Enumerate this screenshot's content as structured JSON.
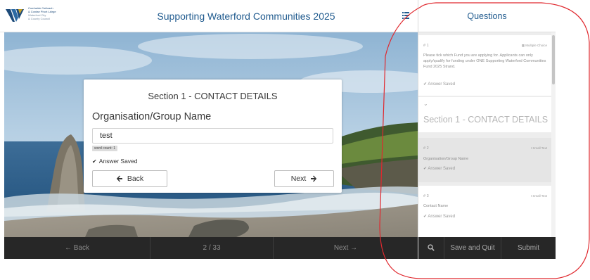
{
  "header": {
    "logo_lines": [
      "Comhairle Cathrach",
      "& Contae Phort Láirge",
      "Waterford City",
      "& County Council"
    ],
    "title": "Supporting Waterford Communities 2025",
    "toggle_icon": "list-icon"
  },
  "card": {
    "section_title": "Section 1 - CONTACT DETAILS",
    "question_title": "Organisation/Group Name",
    "answer_value": "test",
    "word_count": "word count: 1",
    "saved_text": "Answer Saved",
    "back_label": "Back",
    "next_label": "Next"
  },
  "bottom_nav": {
    "back_label": "Back",
    "progress": "2 / 33",
    "next_label": "Next"
  },
  "questions_panel": {
    "title": "Questions",
    "items": [
      {
        "number": "# 1",
        "type": "Multiple Choice",
        "text": "Please tick which Fund you are applying for. Applicants can only apply/qualify for funding under ONE Supporting Waterford Communities Fund 2025 Strand.",
        "saved": "Answer Saved"
      },
      {
        "section": "Section 1 - CONTACT DETAILS"
      },
      {
        "number": "# 2",
        "type": "Small Text",
        "text": "Organisation/Group Name",
        "saved": "Answer Saved"
      },
      {
        "number": "# 3",
        "type": "Small Text",
        "text": "Contact Name",
        "saved": "Answer Saved"
      }
    ],
    "footer": {
      "search_icon": "search-icon",
      "save_quit_label": "Save and Quit",
      "submit_label": "Submit"
    }
  },
  "colors": {
    "accent": "#1f5a8e",
    "footer_bg": "#272727",
    "annotation": "#e0282e"
  }
}
